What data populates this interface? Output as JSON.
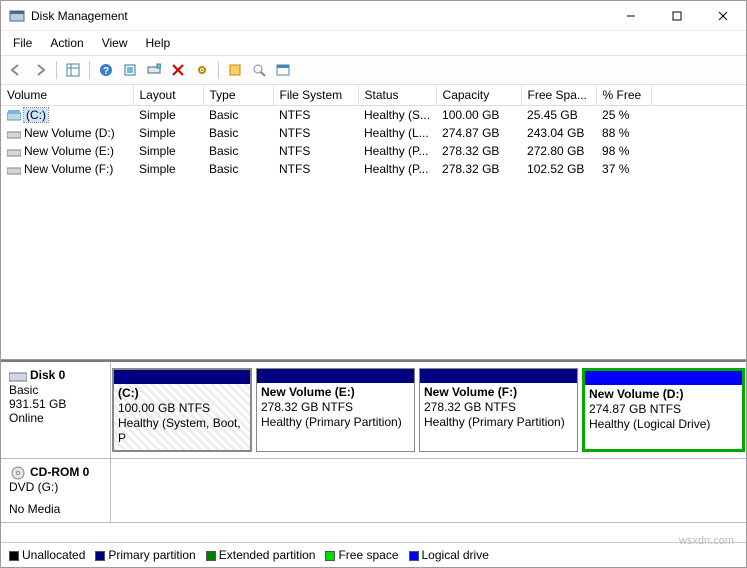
{
  "window": {
    "title": "Disk Management"
  },
  "menu": {
    "file": "File",
    "action": "Action",
    "view": "View",
    "help": "Help"
  },
  "columns": {
    "volume": "Volume",
    "layout": "Layout",
    "type": "Type",
    "fs": "File System",
    "status": "Status",
    "capacity": "Capacity",
    "freespace": "Free Spa...",
    "pctfree": "% Free"
  },
  "rows": [
    {
      "name": "(C:)",
      "layout": "Simple",
      "type": "Basic",
      "fs": "NTFS",
      "status": "Healthy (S...",
      "capacity": "100.00 GB",
      "free": "25.45 GB",
      "pct": "25 %"
    },
    {
      "name": "New Volume (D:)",
      "layout": "Simple",
      "type": "Basic",
      "fs": "NTFS",
      "status": "Healthy (L...",
      "capacity": "274.87 GB",
      "free": "243.04 GB",
      "pct": "88 %"
    },
    {
      "name": "New Volume (E:)",
      "layout": "Simple",
      "type": "Basic",
      "fs": "NTFS",
      "status": "Healthy (P...",
      "capacity": "278.32 GB",
      "free": "272.80 GB",
      "pct": "98 %"
    },
    {
      "name": "New Volume (F:)",
      "layout": "Simple",
      "type": "Basic",
      "fs": "NTFS",
      "status": "Healthy (P...",
      "capacity": "278.32 GB",
      "free": "102.52 GB",
      "pct": "37 %"
    }
  ],
  "disk0": {
    "name": "Disk 0",
    "type": "Basic",
    "size": "931.51 GB",
    "state": "Online",
    "parts": [
      {
        "name": "(C:)",
        "line2": "100.00 GB NTFS",
        "line3": "Healthy (System, Boot, P"
      },
      {
        "name": "New Volume  (E:)",
        "line2": "278.32 GB NTFS",
        "line3": "Healthy (Primary Partition)"
      },
      {
        "name": "New Volume  (F:)",
        "line2": "278.32 GB NTFS",
        "line3": "Healthy (Primary Partition)"
      },
      {
        "name": "New Volume  (D:)",
        "line2": "274.87 GB NTFS",
        "line3": "Healthy (Logical Drive)"
      }
    ]
  },
  "cdrom": {
    "name": "CD-ROM 0",
    "sub": "DVD (G:)",
    "state": "No Media"
  },
  "legend": {
    "unalloc": "Unallocated",
    "primary": "Primary partition",
    "extended": "Extended partition",
    "free": "Free space",
    "logical": "Logical drive"
  },
  "watermark": "wsxdn.com"
}
